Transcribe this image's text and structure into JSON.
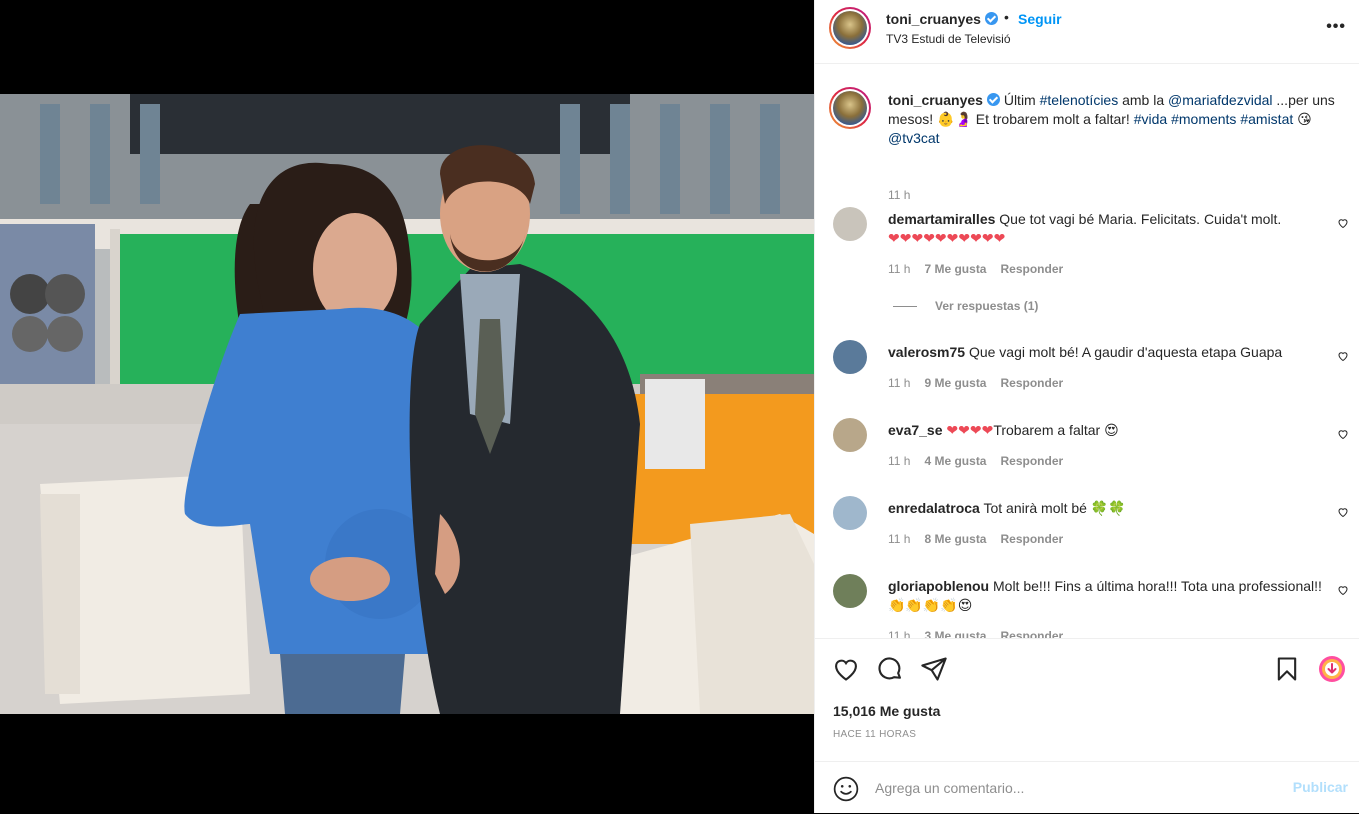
{
  "post": {
    "username": "toni_cruanyes",
    "follow_label": "Seguir",
    "separator": "•",
    "location": "TV3 Estudi de Televisió",
    "more_label": "•••"
  },
  "caption": {
    "username": "toni_cruanyes",
    "t1": "Últim ",
    "tag1": "#telenotícies",
    "t2": " amb la ",
    "tag2": "@mariafdezvidal",
    "t3": " ...per uns mesos! 👶🤰 Et trobarem molt a faltar! ",
    "tag3": "#vida",
    "t4": " ",
    "tag4": "#moments",
    "t5": " ",
    "tag5": "#amistat",
    "t6": " 😘 ",
    "tag6": "@tv3cat",
    "time": "11 h"
  },
  "comments": [
    {
      "username": "demartamiralles",
      "text": "Que tot vagi bé Maria. Felicitats. Cuida't molt.",
      "hearts": "❤❤❤❤❤❤❤❤❤❤",
      "time": "11 h",
      "likes": "7 Me gusta",
      "reply": "Responder",
      "avatar_color": "#c9c4bb"
    },
    {
      "username": "valerosm75",
      "text": "Que vagi molt bé! A gaudir d'aquesta etapa Guapa",
      "time": "11 h",
      "likes": "9 Me gusta",
      "reply": "Responder",
      "avatar_color": "#5a7a9a"
    },
    {
      "username": "eva7_se",
      "text_hearts": "❤❤❤❤",
      "text": "Trobarem a faltar 😍",
      "time": "11 h",
      "likes": "4 Me gusta",
      "reply": "Responder",
      "avatar_color": "#b8a78a"
    },
    {
      "username": "enredalatroca",
      "text": "Tot anirà molt bé 🍀🍀",
      "time": "11 h",
      "likes": "8 Me gusta",
      "reply": "Responder",
      "avatar_color": "#9fb7cc"
    },
    {
      "username": "gloriapoblenou",
      "text": "Molt be!!! Fins a última hora!!! Tota una professional!!👏👏👏👏😍",
      "time": "11 h",
      "likes": "3 Me gusta",
      "reply": "Responder",
      "avatar_color": "#6f7f5a"
    }
  ],
  "view_replies": "Ver respuestas (1)",
  "likes_count": "15,016 Me gusta",
  "posted_ago": "HACE 11 HORAS",
  "comment_input": {
    "placeholder": "Agrega un comentario...",
    "post_label": "Publicar"
  },
  "colors": {
    "link": "#0095f6",
    "tag": "#00376b",
    "muted": "#8e8e8e",
    "heart": "#ed4956"
  }
}
